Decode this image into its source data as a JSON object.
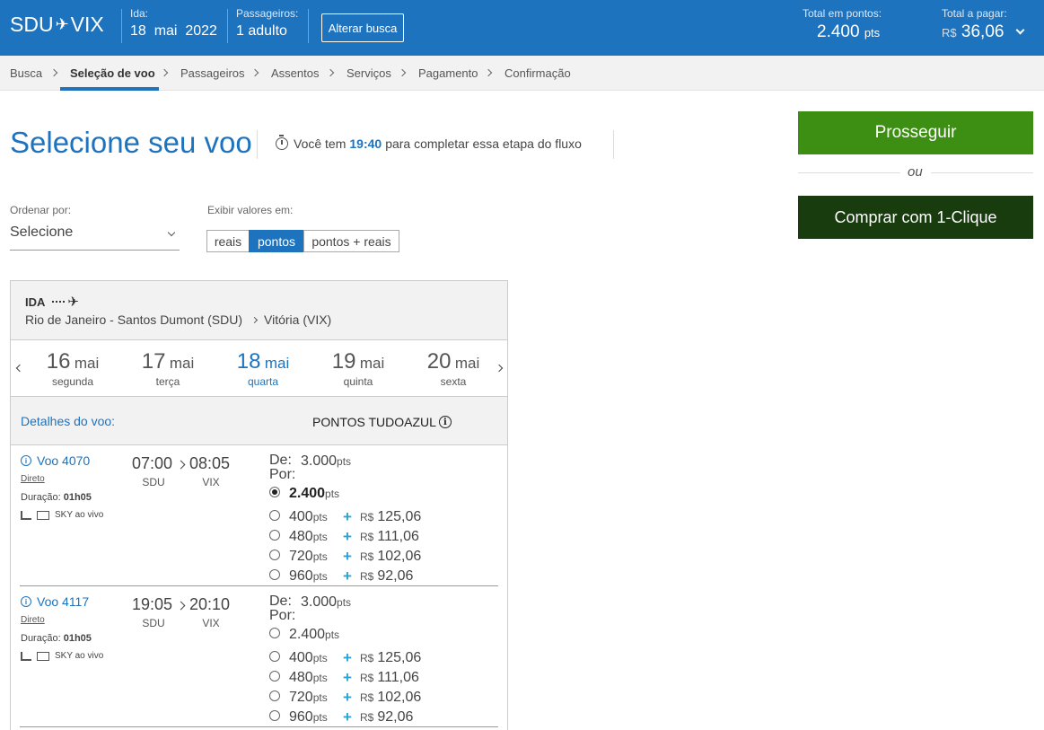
{
  "header": {
    "route_from": "SDU",
    "route_to": "VIX",
    "ida_label": "Ida:",
    "ida_day": "18",
    "ida_month": "mai",
    "ida_year": "2022",
    "pass_label": "Passageiros:",
    "pass_value": "1 adulto",
    "alter_label": "Alterar busca",
    "points_label": "Total em pontos:",
    "points_value": "2.400",
    "points_unit": "pts",
    "pay_label": "Total a pagar:",
    "pay_currency": "R$",
    "pay_value": "36,06"
  },
  "steps": [
    "Busca",
    "Seleção de voo",
    "Passageiros",
    "Assentos",
    "Serviços",
    "Pagamento",
    "Confirmação"
  ],
  "title": "Selecione seu voo",
  "timer": {
    "prefix": "Você tem",
    "time": "19:40",
    "suffix": "para completar essa etapa do fluxo"
  },
  "sort": {
    "label": "Ordenar por:",
    "value": "Selecione"
  },
  "display": {
    "label": "Exibir valores em:",
    "options": [
      "reais",
      "pontos",
      "pontos + reais"
    ],
    "selected": "pontos"
  },
  "cta": {
    "proceed": "Prosseguir",
    "or": "ou",
    "one_click": "Comprar com 1-Clique"
  },
  "panel": {
    "direction": "IDA",
    "origin": "Rio de Janeiro - Santos Dumont (SDU)",
    "destination": "Vitória (VIX)",
    "dates": [
      {
        "num": "16",
        "mon": "mai",
        "day": "segunda"
      },
      {
        "num": "17",
        "mon": "mai",
        "day": "terça"
      },
      {
        "num": "18",
        "mon": "mai",
        "day": "quarta"
      },
      {
        "num": "19",
        "mon": "mai",
        "day": "quinta"
      },
      {
        "num": "20",
        "mon": "mai",
        "day": "sexta"
      }
    ],
    "details_label": "Detalhes do voo:",
    "points_header": "PONTOS TUDOAZUL",
    "info_glyph": "i"
  },
  "flight_common": {
    "direct": "Direto",
    "duration_label": "Duração:",
    "amenity": "SKY ao vivo",
    "de": "De:",
    "por": "Por:",
    "pts": "pts",
    "currency": "R$",
    "plus": "+"
  },
  "flights": [
    {
      "code": "Voo 4070",
      "duration": "01h05",
      "dep": "07:00",
      "arr": "08:05",
      "from": "SDU",
      "to": "VIX",
      "old_price": "3.000",
      "options": [
        {
          "pts": "2.400",
          "reais": ""
        },
        {
          "pts": "400",
          "reais": "125,06"
        },
        {
          "pts": "480",
          "reais": "111,06"
        },
        {
          "pts": "720",
          "reais": "102,06"
        },
        {
          "pts": "960",
          "reais": "92,06"
        }
      ]
    },
    {
      "code": "Voo 4117",
      "duration": "01h05",
      "dep": "19:05",
      "arr": "20:10",
      "from": "SDU",
      "to": "VIX",
      "old_price": "3.000",
      "options": [
        {
          "pts": "2.400",
          "reais": ""
        },
        {
          "pts": "400",
          "reais": "125,06"
        },
        {
          "pts": "480",
          "reais": "111,06"
        },
        {
          "pts": "720",
          "reais": "102,06"
        },
        {
          "pts": "960",
          "reais": "92,06"
        }
      ]
    }
  ]
}
